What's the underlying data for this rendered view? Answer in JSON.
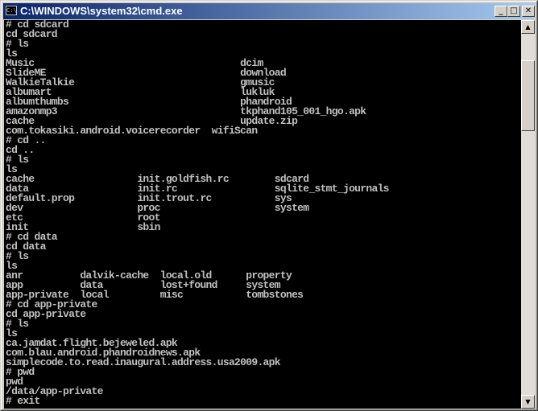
{
  "window": {
    "title": "C:\\WINDOWS\\system32\\cmd.exe",
    "icon": "cmd-icon",
    "icon_text": "C:\\",
    "buttons": {
      "minimize": "_",
      "maximize": "□",
      "close": "✕"
    }
  },
  "console": {
    "lines": [
      "# cd sdcard",
      "cd sdcard",
      "# ls",
      "ls",
      "Music                                    dcim",
      "SlideME                                  download",
      "WalkieTalkie                             gmusic",
      "albumart                                 lukluk",
      "albumthumbs                              phandroid",
      "amazonmp3                                tkphand105_001_hgo.apk",
      "cache                                    update.zip",
      "com.tokasiki.android.voicerecorder  wifiScan",
      "# cd ..",
      "cd ..",
      "# ls",
      "ls",
      "cache                  init.goldfish.rc        sdcard",
      "data                   init.rc                 sqlite_stmt_journals",
      "default.prop           init.trout.rc           sys",
      "dev                    proc                    system",
      "etc                    root",
      "init                   sbin",
      "# cd data",
      "cd data",
      "# ls",
      "ls",
      "anr          dalvik-cache  local.old      property",
      "app          data          lost+found     system",
      "app-private  local         misc           tombstones",
      "# cd app-private",
      "cd app-private",
      "# ls",
      "ls",
      "ca.jamdat.flight.bejeweled.apk",
      "com.blau.android.phandroidnews.apk",
      "simplecode.to.read.inaugural.address.usa2009.apk",
      "# pwd",
      "pwd",
      "/data/app-private",
      "# exit"
    ]
  },
  "scrollbar": {
    "up_arrow": "▲",
    "down_arrow": "▼"
  }
}
